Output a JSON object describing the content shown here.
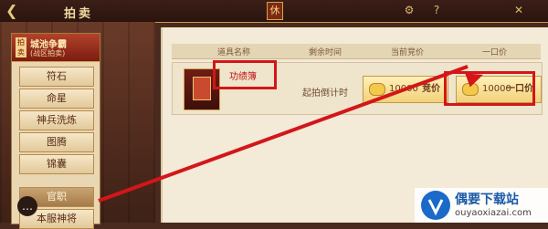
{
  "header": {
    "title": "拍卖",
    "tab_label": "休"
  },
  "sidebar": {
    "badge": "拍卖",
    "title": "城池争霸",
    "subtitle": "(战区拍卖)",
    "items": [
      {
        "label": "符石"
      },
      {
        "label": "命星"
      },
      {
        "label": "神兵洗炼"
      },
      {
        "label": "图腾"
      },
      {
        "label": "锦囊"
      },
      {
        "label": "官职"
      },
      {
        "label": "本服神将"
      }
    ]
  },
  "table": {
    "headers": [
      "道具名称",
      "剩余时间",
      "当前竞价",
      "一口价"
    ],
    "rows": [
      {
        "name": "功绩簿",
        "remaining": "起拍倒计时",
        "bid_amount": "10000",
        "bid_label": "竞价",
        "buyout_amount": "10000",
        "buyout_label": "一口价"
      }
    ]
  },
  "watermark": {
    "text": "偶要下载站",
    "url": "ouyaoxiazai.com"
  },
  "colors": {
    "annotation_red": "#d3161a",
    "accent_gold": "#f2d17a"
  }
}
